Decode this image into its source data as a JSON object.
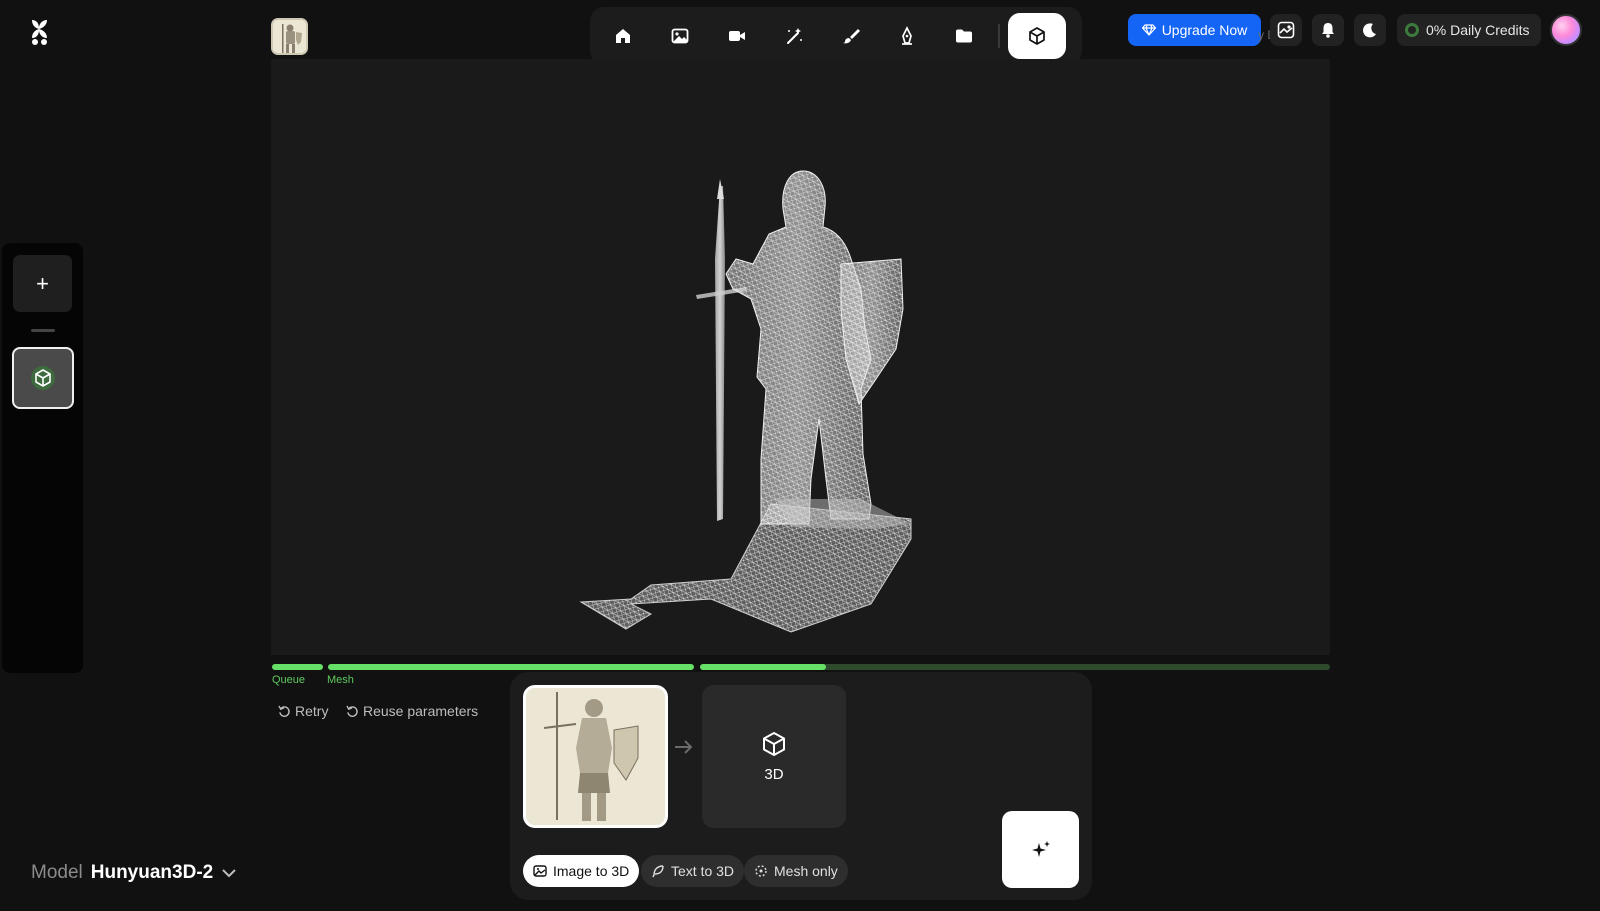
{
  "header": {
    "upgrade_label": "Upgrade Now",
    "ghost_text": "y  D",
    "credits_label": "0% Daily Credits",
    "accent_color": "#1464f6"
  },
  "toolbar": {
    "tools": [
      {
        "name": "home-icon"
      },
      {
        "name": "image-icon"
      },
      {
        "name": "video-icon"
      },
      {
        "name": "magic-wand-icon"
      },
      {
        "name": "brush-icon"
      },
      {
        "name": "pen-nib-icon"
      },
      {
        "name": "folder-icon"
      },
      {
        "name": "cube-icon",
        "active": true
      }
    ]
  },
  "progress": {
    "stages": [
      {
        "label": "Queue",
        "fraction": 1.0
      },
      {
        "label": "Mesh",
        "fraction": 1.0
      },
      {
        "label": "",
        "fraction": 0.2
      }
    ],
    "color": "#5fe05f"
  },
  "actions": {
    "retry_label": "Retry",
    "reuse_label": "Reuse parameters"
  },
  "generator": {
    "output_label": "3D",
    "modes": [
      {
        "label": "Image to 3D",
        "active": true
      },
      {
        "label": "Text to 3D",
        "active": false
      },
      {
        "label": "Mesh only",
        "active": false
      }
    ]
  },
  "model": {
    "label": "Model",
    "value": "Hunyuan3D-2"
  }
}
